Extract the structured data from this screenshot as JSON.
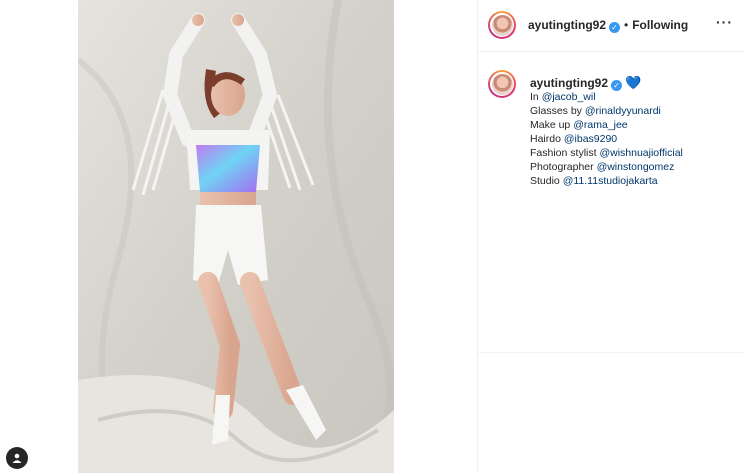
{
  "post": {
    "username": "ayutingting92",
    "follow_status": "Following",
    "more_icon": "more-horizontal-icon",
    "verified_icon": "verified-badge-icon"
  },
  "caption": {
    "username": "ayutingting92",
    "heart": "💙",
    "lines": [
      {
        "prefix": "In ",
        "mention": "@jacob_wil"
      },
      {
        "prefix": "Glasses by ",
        "mention": "@rinaldyyunardi"
      },
      {
        "prefix": "Make up ",
        "mention": "@rama_jee"
      },
      {
        "prefix": "Hairdo ",
        "mention": "@ibas9290"
      },
      {
        "prefix": "Fashion stylist ",
        "mention": "@wishnuajiofficial"
      },
      {
        "prefix": "Photographer ",
        "mention": "@winstongomez"
      },
      {
        "prefix": "Studio ",
        "mention": "@11.11studiojakarta"
      }
    ]
  },
  "colors": {
    "verified": "#3897f0",
    "mention": "#00376b",
    "divider": "#efefef",
    "backdrop": "#dcd9d4"
  }
}
